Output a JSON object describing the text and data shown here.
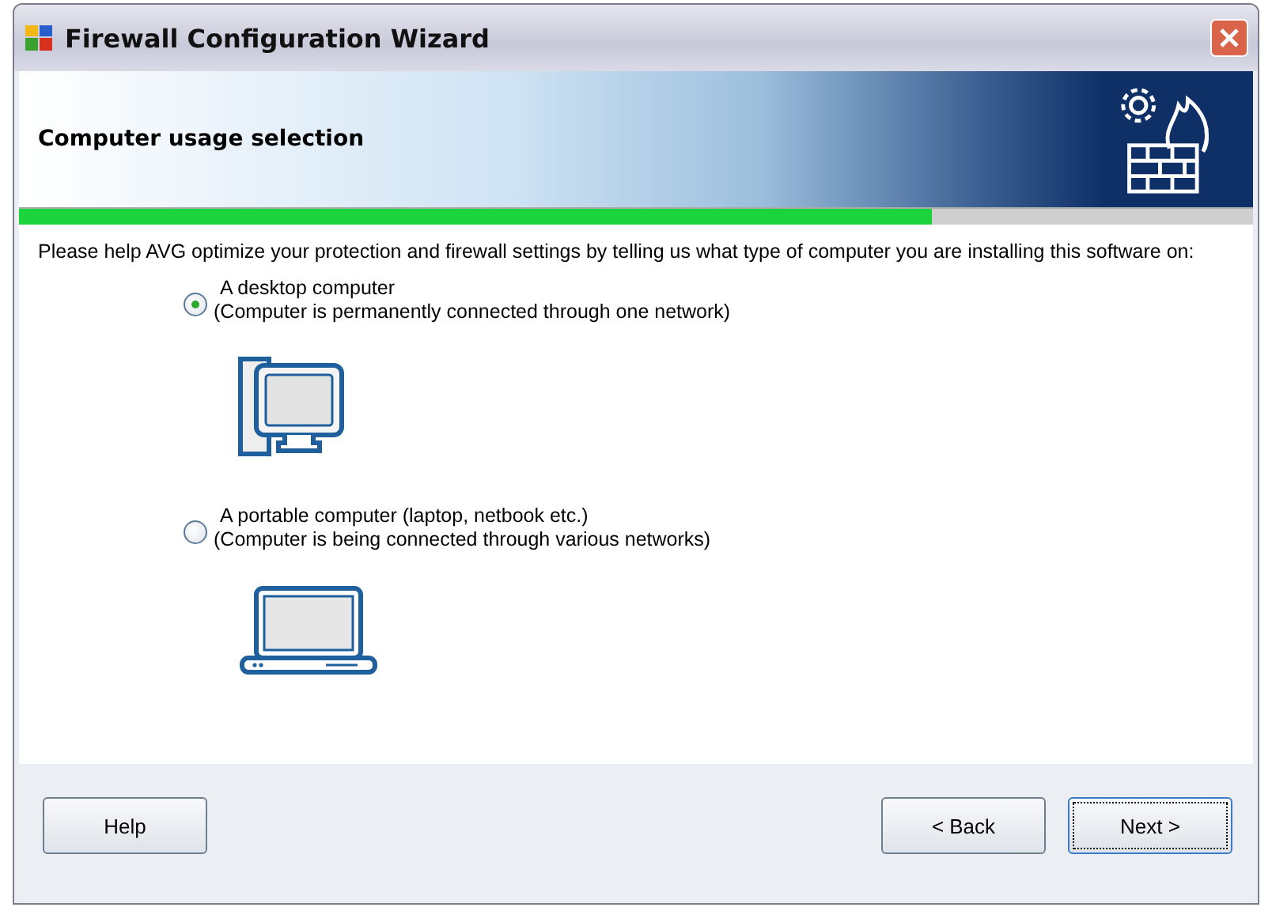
{
  "window": {
    "title": "Firewall Configuration Wizard"
  },
  "header": {
    "title": "Computer usage selection"
  },
  "progress": {
    "level": 0.74
  },
  "intro": "Please help AVG optimize your protection and firewall settings by telling us what type of computer you are installing this software on:",
  "options": [
    {
      "kind": "desktop",
      "label": "A desktop computer",
      "description": "(Computer is permanently connected through one network)",
      "selected": true
    },
    {
      "kind": "laptop",
      "label": "A portable computer (laptop, netbook etc.)",
      "description": "(Computer is being connected through various networks)",
      "selected": false
    }
  ],
  "buttons": [
    {
      "kind": "help",
      "label": "Help",
      "focused": false
    },
    {
      "kind": "back",
      "label": "< Back",
      "focused": false
    },
    {
      "kind": "next",
      "label": "Next >",
      "focused": true
    }
  ]
}
